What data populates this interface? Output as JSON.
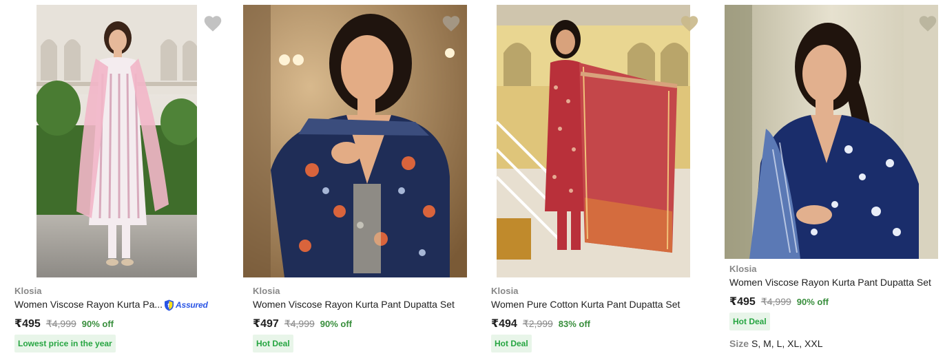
{
  "products": [
    {
      "brand": "Klosia",
      "title": "Women Viscose Rayon Kurta Pa...",
      "assured_label": "Assured",
      "price": "₹495",
      "mrp": "₹4,999",
      "discount": "90% off",
      "badge": "Lowest price in the year"
    },
    {
      "brand": "Klosia",
      "title": "Women Viscose Rayon Kurta Pant Dupatta Set",
      "price": "₹497",
      "mrp": "₹4,999",
      "discount": "90% off",
      "badge": "Hot Deal"
    },
    {
      "brand": "Klosia",
      "title": "Women Pure Cotton Kurta Pant Dupatta Set",
      "price": "₹494",
      "mrp": "₹2,999",
      "discount": "83% off",
      "badge": "Hot Deal"
    },
    {
      "brand": "Klosia",
      "title": "Women Viscose Rayon Kurta Pant Dupatta Set",
      "price": "₹495",
      "mrp": "₹4,999",
      "discount": "90% off",
      "badge": "Hot Deal",
      "size_label": "Size",
      "size_values": "S, M, L, XL, XXL"
    }
  ],
  "icons": {
    "wishlist": "heart-icon",
    "assured": "shield-icon"
  },
  "colors": {
    "discount": "#388e3c",
    "badge_text": "#26a541",
    "badge_bg": "#e8f5e9",
    "assured": "#2a55e5",
    "wishlist": "#c2c2c2"
  }
}
